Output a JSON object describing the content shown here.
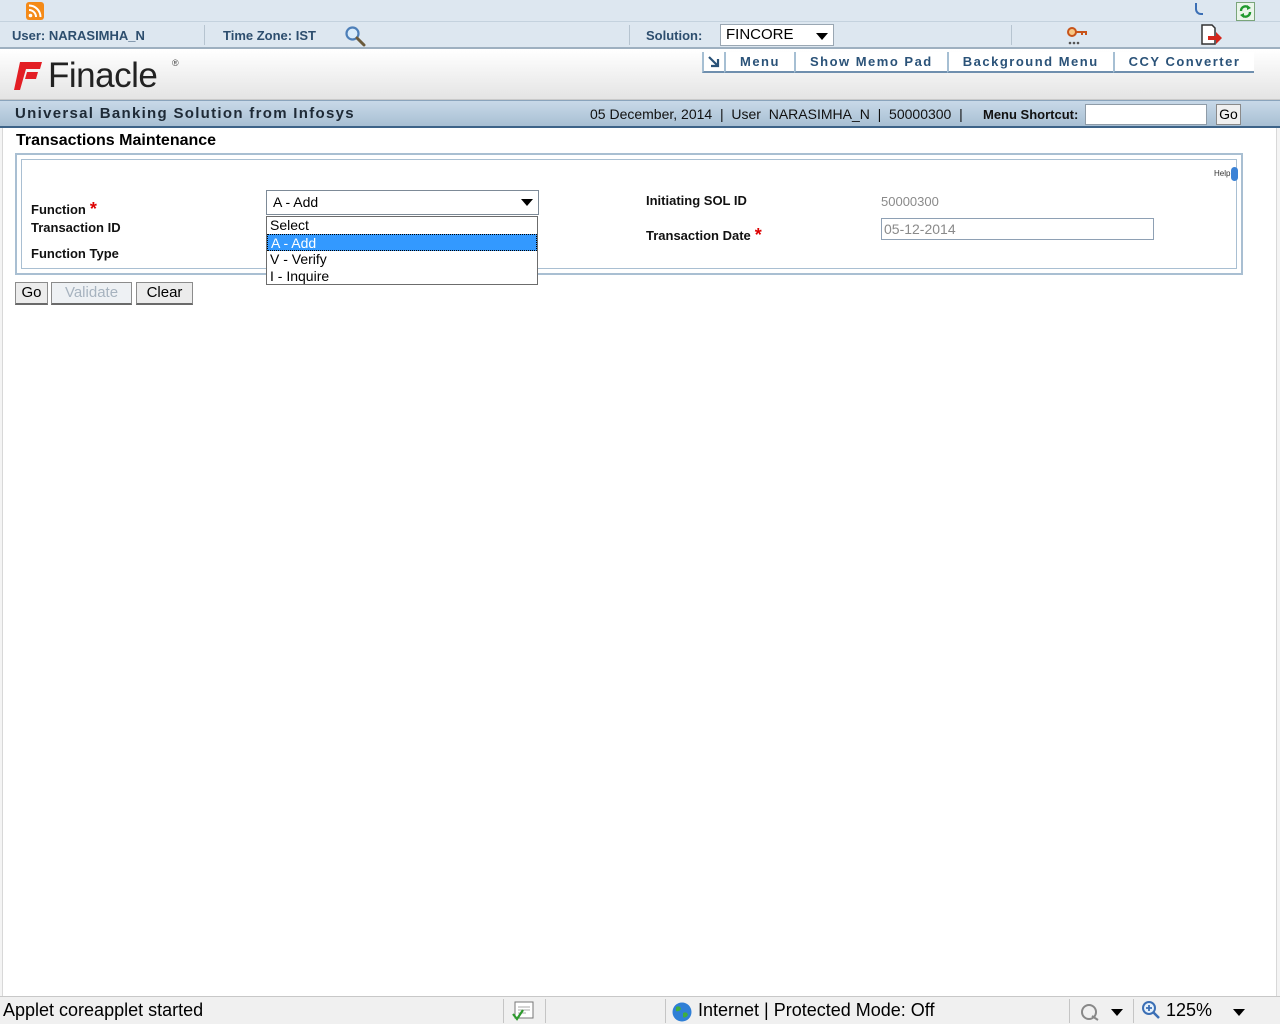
{
  "userbar": {
    "user": "User: NARASIMHA_N",
    "timezone": "Time Zone:  IST",
    "solution_label": "Solution:",
    "solution_value": "FINCORE"
  },
  "header": {
    "logo_text": "Finacle",
    "logo_reg": "®",
    "menu_items": [
      "Menu",
      "Show Memo Pad",
      "Background Menu",
      "CCY Converter"
    ]
  },
  "bluebar": {
    "tagline": "Universal Banking Solution from Infosys",
    "info": "05 December, 2014  |  User  NARASIMHA_N  |  50000300  |",
    "shortcut_label": "Menu Shortcut:",
    "go_label": "Go"
  },
  "page": {
    "title": "Transactions Maintenance",
    "help_label": "Help",
    "labels": {
      "function": "Function",
      "transaction_id": "Transaction ID",
      "function_type": "Function Type",
      "initiating_sol": "Initiating SOL ID",
      "transaction_date": "Transaction Date"
    },
    "required_marker": "*",
    "function_value": "A - Add",
    "function_options": [
      "Select",
      "A - Add",
      "V - Verify",
      "I - Inquire"
    ],
    "initiating_sol_value": "50000300",
    "transaction_date_value": "05-12-2014"
  },
  "buttons": {
    "go": "Go",
    "validate": "Validate",
    "clear": "Clear"
  },
  "statusbar": {
    "status": "Applet coreapplet started",
    "zone": "Internet | Protected Mode: Off",
    "zoom": "125%"
  },
  "colors": {
    "accent": "#2a5278",
    "required": "#dd0000",
    "selection": "#3399ff",
    "logo_red": "#e31e24"
  }
}
